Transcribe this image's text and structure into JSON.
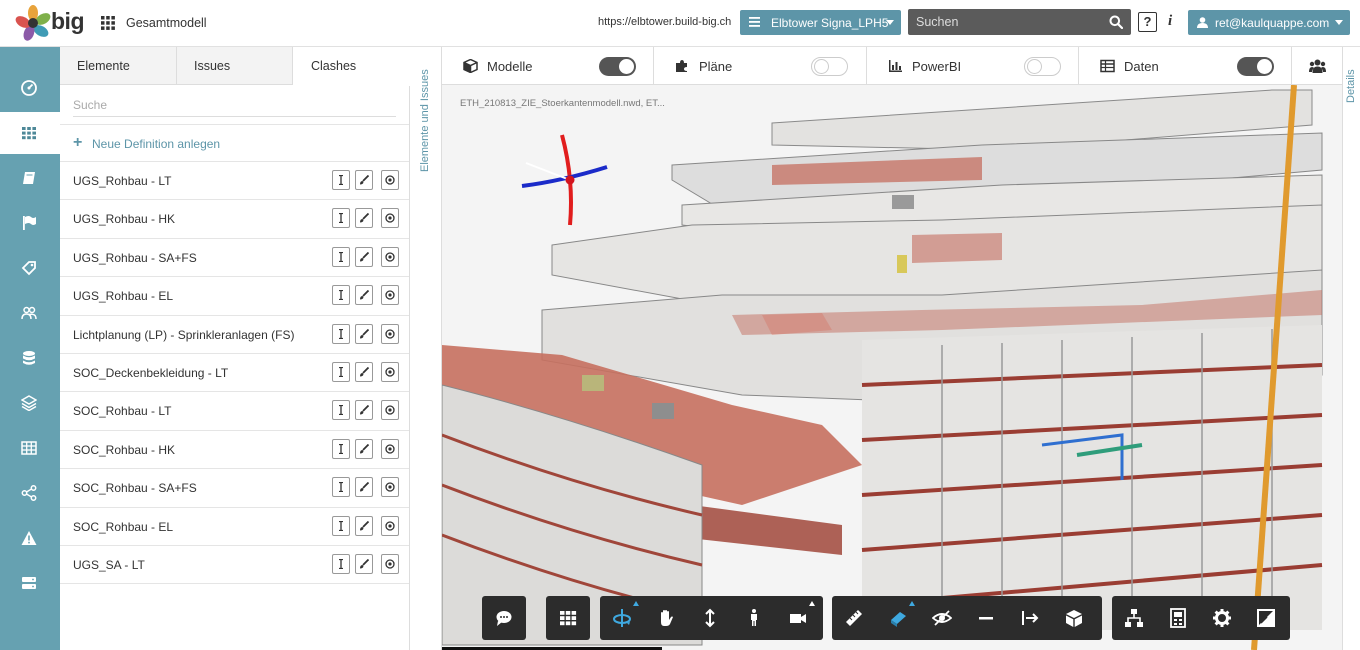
{
  "header": {
    "brand": "big",
    "app_title": "Gesamtmodell",
    "url": "https://elbtower.build-big.ch",
    "project": "Elbtower Signa_LPH5",
    "search_placeholder": "Suchen",
    "help": "?",
    "info": "i",
    "user": "ret@kaulquappe.com"
  },
  "rail": {
    "items": [
      {
        "icon": "dashboard-icon"
      },
      {
        "icon": "grid-icon",
        "active": true
      },
      {
        "icon": "book-icon"
      },
      {
        "icon": "flag-icon"
      },
      {
        "icon": "tags-icon"
      },
      {
        "icon": "users-icon"
      },
      {
        "icon": "database-icon"
      },
      {
        "icon": "layers-icon"
      },
      {
        "icon": "table-icon"
      },
      {
        "icon": "share-icon"
      },
      {
        "icon": "warning-icon"
      },
      {
        "icon": "server-icon"
      }
    ]
  },
  "panel": {
    "tabs": [
      "Elemente",
      "Issues",
      "Clashes"
    ],
    "active_tab": "Clashes",
    "search_placeholder": "Suche",
    "new_definition": "Neue Definition anlegen",
    "rows": [
      "UGS_Rohbau - LT",
      "UGS_Rohbau - HK",
      "UGS_Rohbau - SA+FS",
      "UGS_Rohbau - EL",
      "Lichtplanung (LP) - Sprinkleranlagen (FS)",
      "SOC_Deckenbekleidung - LT",
      "SOC_Rohbau - LT",
      "SOC_Rohbau - HK",
      "SOC_Rohbau - SA+FS",
      "SOC_Rohbau - EL",
      "UGS_SA - LT"
    ]
  },
  "vertical_tab": "Elemente und Issues",
  "viewer": {
    "toolbar": [
      {
        "label": "Modelle",
        "icon": "cube-icon",
        "on": true
      },
      {
        "label": "Pläne",
        "icon": "puzzle-icon",
        "on": false
      },
      {
        "label": "PowerBI",
        "icon": "bar-chart-icon",
        "on": false
      },
      {
        "label": "Daten",
        "icon": "table-icon",
        "on": true
      }
    ],
    "model_file": "ETH_210813_ZIE_Stoerkantenmodell.nwd, ET...",
    "bottom_tools": [
      "comment-icon",
      "grid-icon",
      "orbit-icon",
      "pan-icon",
      "vertical-move-icon",
      "walk-icon",
      "camera-icon",
      "ruler-icon",
      "section-icon",
      "hide-icon",
      "minus-icon",
      "explode-icon",
      "cube-3d-icon",
      "tree-icon",
      "properties-icon",
      "settings-icon",
      "fullscreen-icon"
    ]
  },
  "details_tab": "Details",
  "colors": {
    "accent": "#5d95a8",
    "rail": "#66a1b1",
    "toolbar_dark": "#2c2c2c",
    "active_tool": "#3fa9e0"
  }
}
